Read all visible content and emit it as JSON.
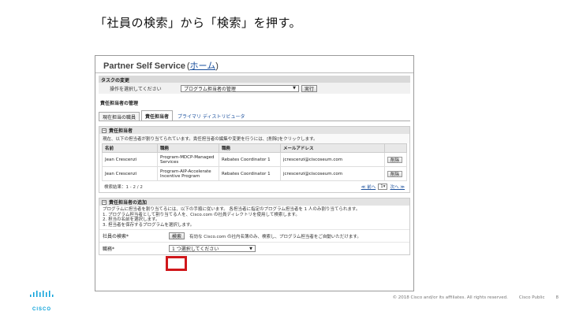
{
  "slide": {
    "title": "「社員の検索」から「検索」を押す。",
    "footer_copyright": "© 2018 Cisco and/or its affiliates. All rights reserved.",
    "footer_label": "Cisco Public",
    "page_number": "8",
    "logo_text": "CISCO"
  },
  "app": {
    "title": "Partner Self Service",
    "home_open": "(",
    "home_link": "ホーム",
    "home_close": ")"
  },
  "task": {
    "header": "タスクの変更",
    "label": "操作を選択してください",
    "selected": "プログラム担当者の管理",
    "go_button": "実行"
  },
  "management": {
    "header": "責任担当者の管理",
    "tabs": [
      {
        "label": "現在担当の職員"
      },
      {
        "label": "責任担当者"
      },
      {
        "label": "プライマリ ディストリビュータ"
      }
    ]
  },
  "responsible": {
    "header": "責任担当者",
    "toggle": "−",
    "description": "現在、以下の担当者が割り当てられています。責任担当者の編集や変更を行うには、[削除]をクリックします。",
    "columns": [
      "名前",
      "職務",
      "職務",
      "メールアドレス",
      ""
    ],
    "rows": [
      {
        "name": "Jean Crescenzi",
        "program": "Program-MDCP-Managed Services",
        "role": "Rebates Coordinator 1",
        "email": "jcrescenzi@ciscoseum.com",
        "action": "削除"
      },
      {
        "name": "Jean Crescenzi",
        "program": "Program-AIP-Accelerate Incentive Program",
        "role": "Rebates Coordinator 1",
        "email": "jcrescenzi@ciscoseum.com",
        "action": "削除"
      }
    ],
    "result_text": "検索結果：1 - 2 / 2",
    "prev": "≪ 前へ",
    "page_value": "1",
    "next": "次へ ≫"
  },
  "add": {
    "header": "責任担当者の追加",
    "toggle": "−",
    "lines": [
      "プログラムに担当者を割り当てるには、以下の手順に従います。 各担当者に指定のプログラム担当者を 1 人のみ割り当てられます。",
      "1. プログラム担当者として割り当てる人を、Cisco.com の社員ディレクトリを使用して検索します。",
      "2. 担当の名前を選択します。",
      "3. 担当者を保存するプログラムを選択します。"
    ],
    "employee_label": "社員の検索*",
    "search_button": "検索",
    "search_hint": "有効な Cisco.com の社内名簿のみ、検索し、プログラム担当者をご自動いただけます。",
    "role_label": "職務*",
    "role_select": "1 つ選択してください"
  }
}
